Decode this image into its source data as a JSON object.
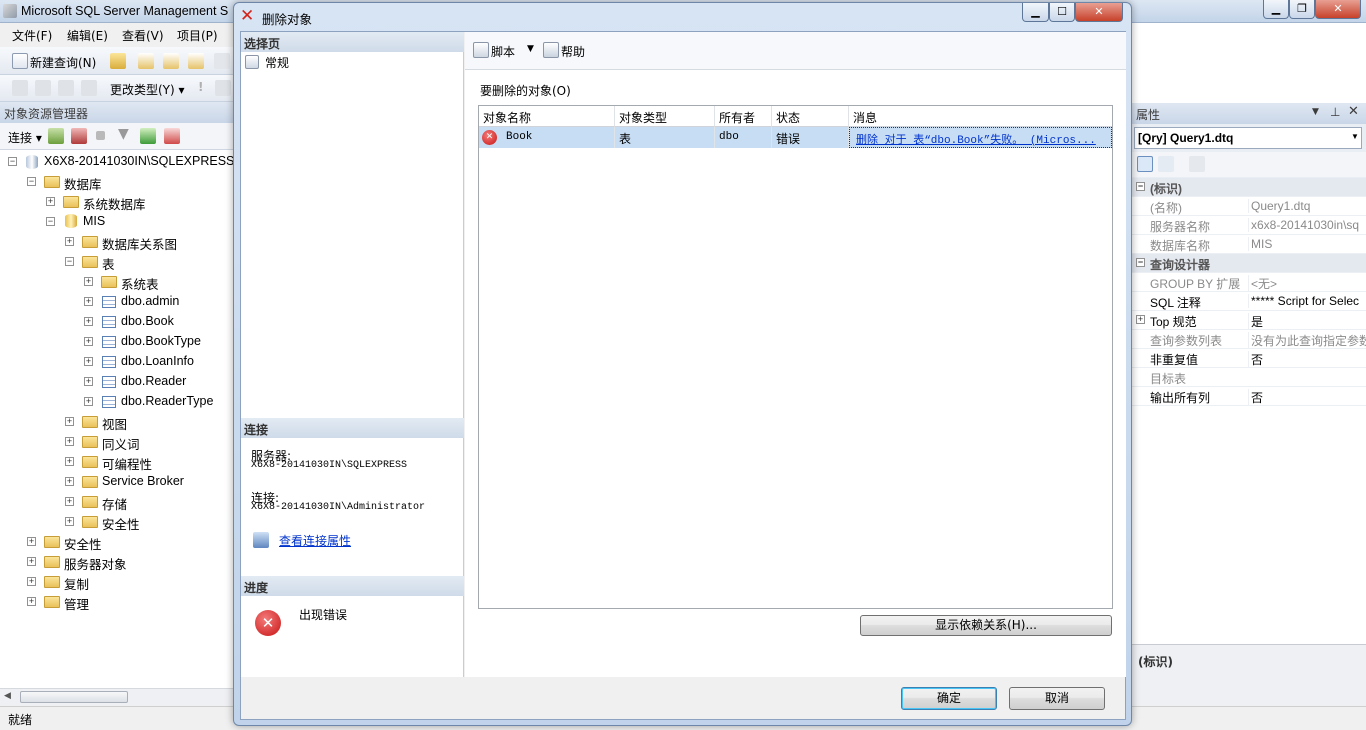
{
  "app": {
    "title": "Microsoft SQL Server Management S"
  },
  "menu": {
    "items": [
      "文件(F)",
      "编辑(E)",
      "查看(V)",
      "项目(P)"
    ]
  },
  "toolbar": {
    "new_query": "新建查询(N)",
    "change_type": "更改类型(Y)"
  },
  "object_explorer": {
    "title": "对象资源管理器",
    "connect": "连接",
    "tree": {
      "server": "X6X8-20141030IN\\SQLEXPRESS",
      "databases": "数据库",
      "system_databases": "系统数据库",
      "mis": "MIS",
      "db_diagrams": "数据库关系图",
      "tables": "表",
      "system_tables": "系统表",
      "t_admin": "dbo.admin",
      "t_book": "dbo.Book",
      "t_booktype": "dbo.BookType",
      "t_loaninfo": "dbo.LoanInfo",
      "t_reader": "dbo.Reader",
      "t_readertype": "dbo.ReaderType",
      "views": "视图",
      "synonyms": "同义词",
      "programmability": "可编程性",
      "service_broker": "Service Broker",
      "storage": "存储",
      "db_security": "安全性",
      "security": "安全性",
      "server_objects": "服务器对象",
      "replication": "复制",
      "management": "管理"
    }
  },
  "status": {
    "text": "就绪"
  },
  "properties": {
    "title": "属性",
    "object": "[Qry] Query1.dtq",
    "rows": [
      {
        "kind": "cat",
        "name": "(标识)"
      },
      {
        "kind": "prop",
        "name": "(名称)",
        "value": "Query1.dtq",
        "grey": true
      },
      {
        "kind": "prop",
        "name": "服务器名称",
        "value": "x6x8-20141030in\\sq",
        "grey": true
      },
      {
        "kind": "prop",
        "name": "数据库名称",
        "value": "MIS",
        "grey": true
      },
      {
        "kind": "cat",
        "name": "查询设计器"
      },
      {
        "kind": "prop",
        "name": "GROUP BY 扩展",
        "value": "<无>",
        "grey": true
      },
      {
        "kind": "prop",
        "name": "SQL 注释",
        "value": "***** Script for Selec",
        "grey": false
      },
      {
        "kind": "prop",
        "name": "Top 规范",
        "value": "是",
        "grey": false,
        "expandable": true
      },
      {
        "kind": "prop",
        "name": "查询参数列表",
        "value": "没有为此查询指定参数",
        "grey": true
      },
      {
        "kind": "prop",
        "name": "非重复值",
        "value": "否",
        "grey": false
      },
      {
        "kind": "prop",
        "name": "目标表",
        "value": "",
        "grey": true
      },
      {
        "kind": "prop",
        "name": "输出所有列",
        "value": "否",
        "grey": false
      }
    ],
    "description": "(标识)"
  },
  "dialog": {
    "title": "删除对象",
    "select_page": "选择页",
    "page_general": "常规",
    "connection_header": "连接",
    "server_label": "服务器:",
    "server_value": "X6X8-20141030IN\\SQLEXPRESS",
    "conn_label": "连接:",
    "conn_value": "X6X8-20141030IN\\Administrator",
    "view_conn_props": "查看连接属性",
    "progress_header": "进度",
    "progress_status": "出现错误",
    "script": "脚本",
    "help": "帮助",
    "objects_label": "要删除的对象(O)",
    "columns": [
      "对象名称",
      "对象类型",
      "所有者",
      "状态",
      "消息"
    ],
    "row": {
      "name": "Book",
      "type": "表",
      "owner": "dbo",
      "status": "错误",
      "message": "删除 对于 表“dbo.Book”失败。 (Micros..."
    },
    "show_deps": "显示依赖关系(H)...",
    "ok": "确定",
    "cancel": "取消"
  }
}
